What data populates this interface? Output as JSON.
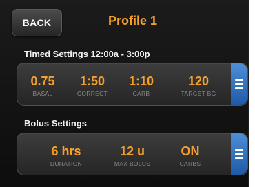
{
  "header": {
    "back_label": "BACK",
    "title": "Profile 1"
  },
  "timed": {
    "label": "Timed Settings  12:00a - 3:00p",
    "items": [
      {
        "value": "0.75",
        "label": "BASAL"
      },
      {
        "value": "1:50",
        "label": "CORRECT"
      },
      {
        "value": "1:10",
        "label": "CARB"
      },
      {
        "value": "120",
        "label": "TARGET BG"
      }
    ]
  },
  "bolus": {
    "label": "Bolus Settings",
    "items": [
      {
        "value": "6 hrs",
        "label": "DURATION"
      },
      {
        "value": "12 u",
        "label": "MAX BOLUS"
      },
      {
        "value": "ON",
        "label": "CARBS"
      }
    ]
  },
  "colors": {
    "accent": "#f6a02b",
    "button_blue": "#2f6dbf",
    "label_gray": "#8a8a8a"
  },
  "icons": {
    "menu": "menu-icon"
  }
}
